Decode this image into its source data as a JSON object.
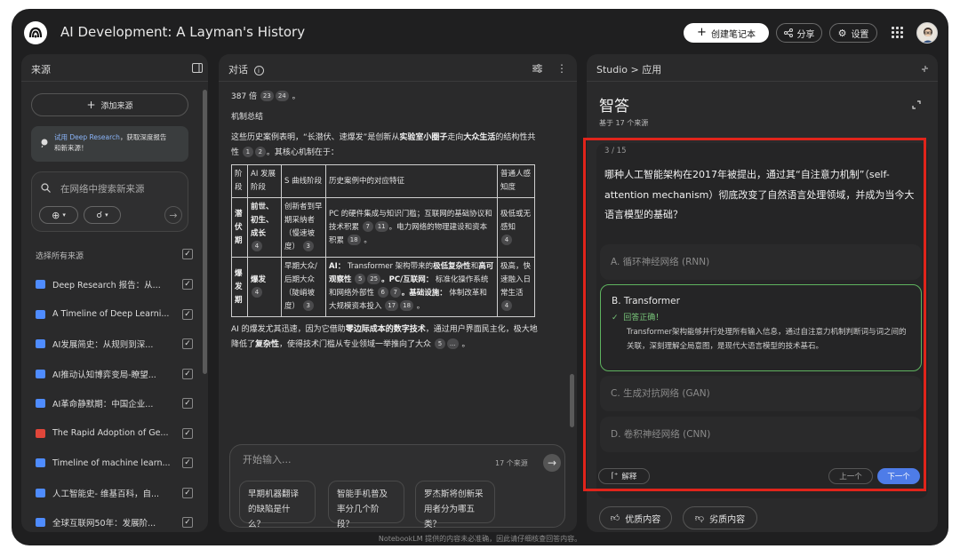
{
  "app": {
    "title": "AI Development: A Layman's History",
    "create_notebook": "创建笔记本",
    "share": "分享",
    "settings": "设置"
  },
  "sources": {
    "title": "来源",
    "add_source": "添加来源",
    "try_research_link": "试用 Deep Research",
    "try_research_rest_1": "，获取深度报告",
    "try_research_rest_2": "和新来源！",
    "search_placeholder": "在网络中搜索新来源",
    "select_all": "选择所有来源",
    "items": [
      {
        "label": "Deep Research 报告：从...",
        "icon_color": "#4f8cff"
      },
      {
        "label": "A Timeline of Deep Learni...",
        "icon_color": "#4f8cff"
      },
      {
        "label": "AI发展简史：从规则到深...",
        "icon_color": "#4f8cff"
      },
      {
        "label": "AI推动认知博弈变局-瞭望...",
        "icon_color": "#4f8cff"
      },
      {
        "label": "AI革命静默期：中国企业...",
        "icon_color": "#4f8cff"
      },
      {
        "label": "The Rapid Adoption of Ge...",
        "icon_color": "#e0463a"
      },
      {
        "label": "Timeline of machine learn...",
        "icon_color": "#4f8cff"
      },
      {
        "label": "人工智能史- 维基百科，自...",
        "icon_color": "#4f8cff"
      },
      {
        "label": "全球互联网50年：发展阶...",
        "icon_color": "#4f8cff"
      }
    ]
  },
  "chat": {
    "title": "对话",
    "line0_text": "387 倍",
    "line0_cites": [
      "23",
      "24"
    ],
    "section_title": "机制总结",
    "para1_a": "这些历史案例表明，“长潜伏、速爆发”是创新从",
    "para1_b": "实验室小圈子",
    "para1_c": "走向",
    "para1_d": "大众生活",
    "para1_e": "的结构性共性",
    "para1_cites": [
      "1",
      "2"
    ],
    "para1_f": "。其核心机制在于：",
    "table_headers": [
      "阶段",
      "AI 发展阶段",
      "S 曲线阶段",
      "历史案例中的对应特征",
      "普通人感知度"
    ],
    "row1": {
      "stage": "潜伏期",
      "ai": "前世、初生、成长",
      "ai_cite": "4",
      "s": "创新者到早期采纳者（慢速坡度）",
      "s_cite": "3",
      "hist_a": "PC 的硬件集成与知识门槛；互联网的基础协议和技术积累",
      "hist_c1": [
        "7",
        "11"
      ],
      "hist_b": "。电力网络的物理建设和资本积累",
      "hist_c2": [
        "18"
      ],
      "perc": "极低或无感知",
      "perc_cite": "4"
    },
    "row2": {
      "stage": "爆发期",
      "ai": "爆发",
      "ai_cite": "4",
      "s": "早期大众/后期大众（陡峭坡度）",
      "s_cite": "3",
      "hist_1": "AI：",
      "hist_2": " Transformer 架构带来的",
      "hist_3": "极低复杂性",
      "hist_4": "和",
      "hist_5": "高可观察性",
      "hist_c1": [
        "5",
        "25"
      ],
      "hist_6": "。PC/互联网：",
      "hist_7": " 标准化操作系统和网络外部性",
      "hist_c2": [
        "6",
        "7"
      ],
      "hist_8": "。基础设施：",
      "hist_9": " 体制改革和大规模资本投入",
      "hist_c3": [
        "17",
        "18"
      ],
      "perc": "极高，快速融入日常生活",
      "perc_cite": "4"
    },
    "para2_a": "AI 的爆发尤其迅速，因为它借助",
    "para2_b": "零边际成本的数字技术",
    "para2_c": "，通过用户界面民主化，极大地降低了",
    "para2_d": "复杂性",
    "para2_e": "，使得技术门槛从专业领域一举推向了大众",
    "para2_cites": [
      "5",
      "..."
    ],
    "input_placeholder": "开始输入...",
    "source_count": "17 个来源",
    "suggestions": [
      "早期机器翻译的缺陷是什么？",
      "智能手机普及率分几个阶段？",
      "罗杰斯将创新采用者分为哪五类？"
    ]
  },
  "studio": {
    "crumb_studio": "Studio",
    "crumb_sep": ">",
    "crumb_app": "应用",
    "quiz_title": "智答",
    "quiz_sub": "基于 17 个来源",
    "counter": "3 / 15",
    "question": "哪种人工智能架构在2017年被提出，通过其“自注意力机制”（self-attention mechanism）彻底改变了自然语言处理领域，并成为当今大语言模型的基础？",
    "options": [
      {
        "label": "A.  循环神经网络 (RNN)"
      },
      {
        "label": "B.  Transformer"
      },
      {
        "label": "C.  生成对抗网络 (GAN)"
      },
      {
        "label": "D.  卷积神经网络 (CNN)"
      }
    ],
    "correct_text": "回答正确！",
    "explanation": "Transformer架构能够并行处理所有输入信息，通过自注意力机制判断词与词之间的关联，深刻理解全局意图，是现代大语言模型的技术基石。",
    "explain_btn": "解释",
    "prev_btn": "上一个",
    "next_btn": "下一个",
    "good": "优质内容",
    "bad": "劣质内容"
  },
  "footer": "NotebookLM 提供的内容未必准确，因此请仔细核查回答内容。"
}
